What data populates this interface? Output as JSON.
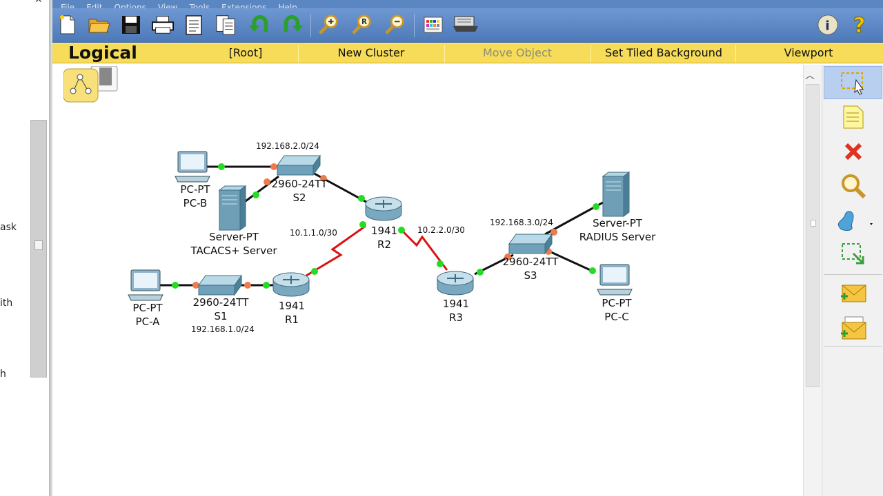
{
  "menubar": {
    "items": [
      "File",
      "Edit",
      "Options",
      "View",
      "Tools",
      "Extensions",
      "Help"
    ]
  },
  "left_panel": {
    "fragments": [
      "ask",
      "ith",
      "h"
    ]
  },
  "navbar": {
    "logical_tab": "Logical",
    "root": "[Root]",
    "new_cluster": "New Cluster",
    "move_object": "Move Object",
    "set_tiled_background": "Set Tiled Background",
    "viewport": "Viewport"
  },
  "toolbar": {
    "icons": [
      "new-file-icon",
      "open-folder-icon",
      "save-icon",
      "print-icon",
      "activity-wizard-icon",
      "copy-icon",
      "undo-icon",
      "redo-icon",
      "zoom-in-icon",
      "zoom-reset-icon",
      "zoom-out-icon",
      "palette-icon",
      "custom-devices-icon",
      "info-icon",
      "help-icon"
    ]
  },
  "right_tools": {
    "icons": [
      "select-icon",
      "note-icon",
      "delete-icon",
      "inspect-icon",
      "draw-shape-icon",
      "resize-icon",
      "add-simple-pdu-icon",
      "add-complex-pdu-icon"
    ]
  },
  "topology": {
    "devices": [
      {
        "id": "pc-b",
        "type": "PC-PT",
        "name": "PC-B"
      },
      {
        "id": "s2",
        "type": "2960-24TT",
        "name": "S2"
      },
      {
        "id": "tacacs",
        "type": "Server-PT",
        "name": "TACACS+ Server"
      },
      {
        "id": "r2",
        "type": "1941",
        "name": "R2"
      },
      {
        "id": "pc-a",
        "type": "PC-PT",
        "name": "PC-A"
      },
      {
        "id": "s1",
        "type": "2960-24TT",
        "name": "S1"
      },
      {
        "id": "r1",
        "type": "1941",
        "name": "R1"
      },
      {
        "id": "r3",
        "type": "1941",
        "name": "R3"
      },
      {
        "id": "s3",
        "type": "2960-24TT",
        "name": "S3"
      },
      {
        "id": "radius",
        "type": "Server-PT",
        "name": "RADIUS Server"
      },
      {
        "id": "pc-c",
        "type": "PC-PT",
        "name": "PC-C"
      }
    ],
    "networks": {
      "lan2": "192.168.2.0/24",
      "wan1": "10.1.1.0/30",
      "wan2": "10.2.2.0/30",
      "lan3": "192.168.3.0/24",
      "lan1": "192.168.1.0/24"
    }
  },
  "colors": {
    "toolbar": "#5a86c2",
    "navbar": "#f6dc58",
    "link_up": "#22dd22",
    "link_orange": "#f07a4a",
    "serial": "#dd1111"
  }
}
